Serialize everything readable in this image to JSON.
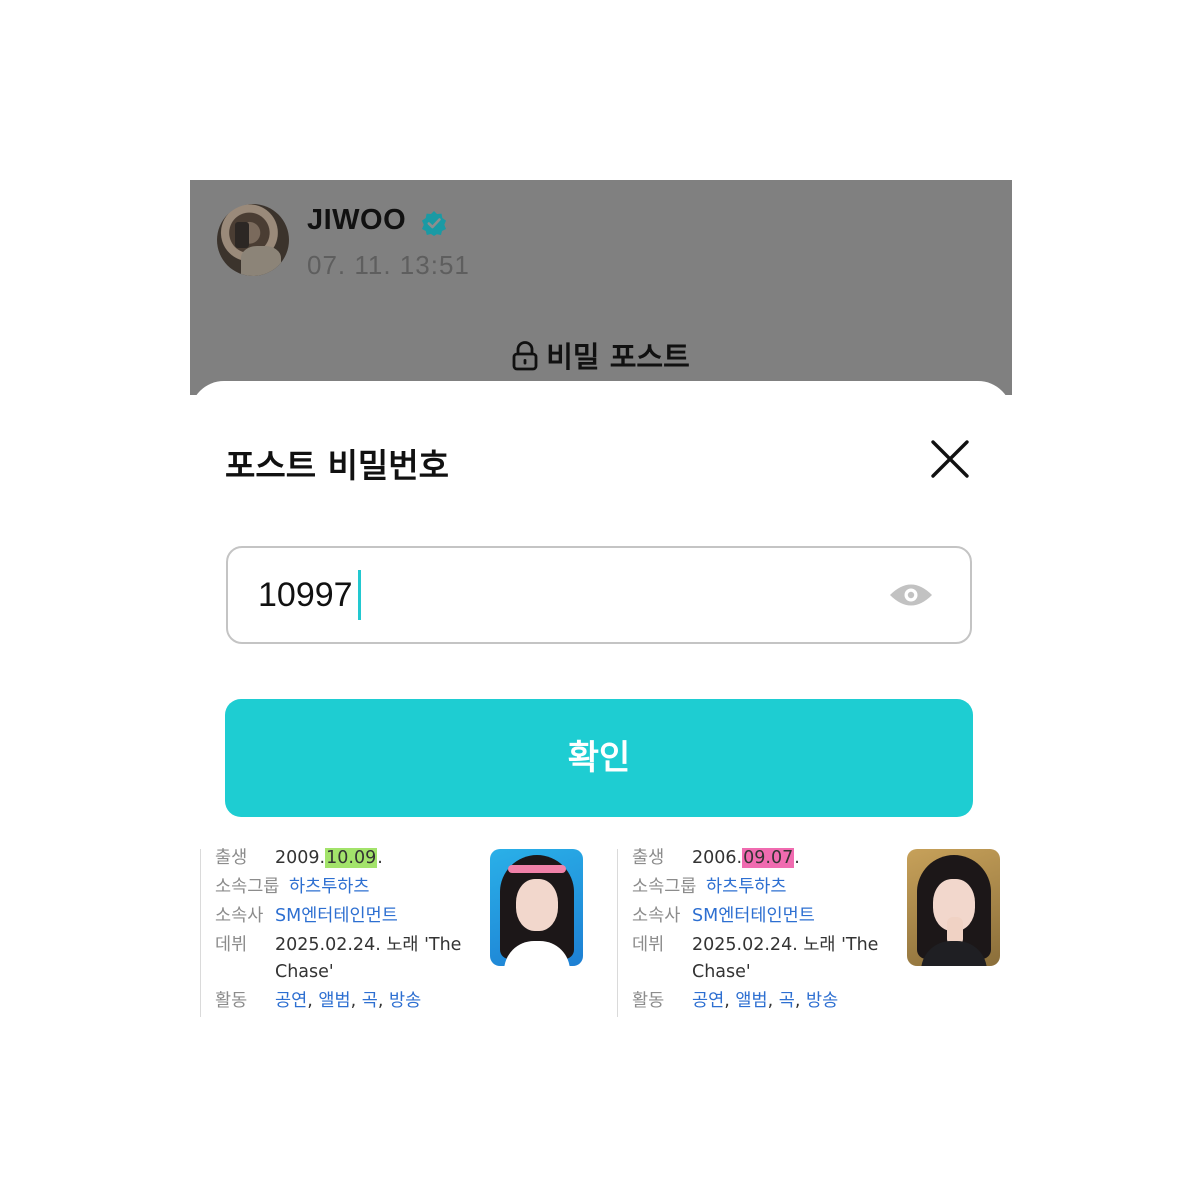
{
  "post": {
    "author": "JIWOO",
    "timestamp": "07. 11. 13:51",
    "secret_label": "비밀 포스트",
    "verified_color": "#1a9aa4"
  },
  "sheet": {
    "title": "포스트 비밀번호",
    "password_value": "10997",
    "confirm_label": "확인",
    "accent_color": "#1ecdd2"
  },
  "profiles": [
    {
      "birth_label": "출생",
      "birth_prefix": "2009.",
      "birth_highlight": "10.09",
      "birth_suffix": ".",
      "highlight_color": "#a3e36b",
      "group_label": "소속그룹",
      "group": "하츠투하츠",
      "agency_label": "소속사",
      "agency": "SM엔터테인먼트",
      "debut_label": "데뷔",
      "debut_line1": "2025.02.24. 노래 'The",
      "debut_line2": "Chase'",
      "activity_label": "활동",
      "activities": [
        "공연",
        "앨범",
        "곡",
        "방송"
      ],
      "separator": ","
    },
    {
      "birth_label": "출생",
      "birth_prefix": "2006.",
      "birth_highlight": "09.07",
      "birth_suffix": ".",
      "highlight_color": "#f06bb0",
      "group_label": "소속그룹",
      "group": "하츠투하츠",
      "agency_label": "소속사",
      "agency": "SM엔터테인먼트",
      "debut_label": "데뷔",
      "debut_line1": "2025.02.24. 노래 'The",
      "debut_line2": "Chase'",
      "activity_label": "활동",
      "activities": [
        "공연",
        "앨범",
        "곡",
        "방송"
      ],
      "separator": ","
    }
  ]
}
